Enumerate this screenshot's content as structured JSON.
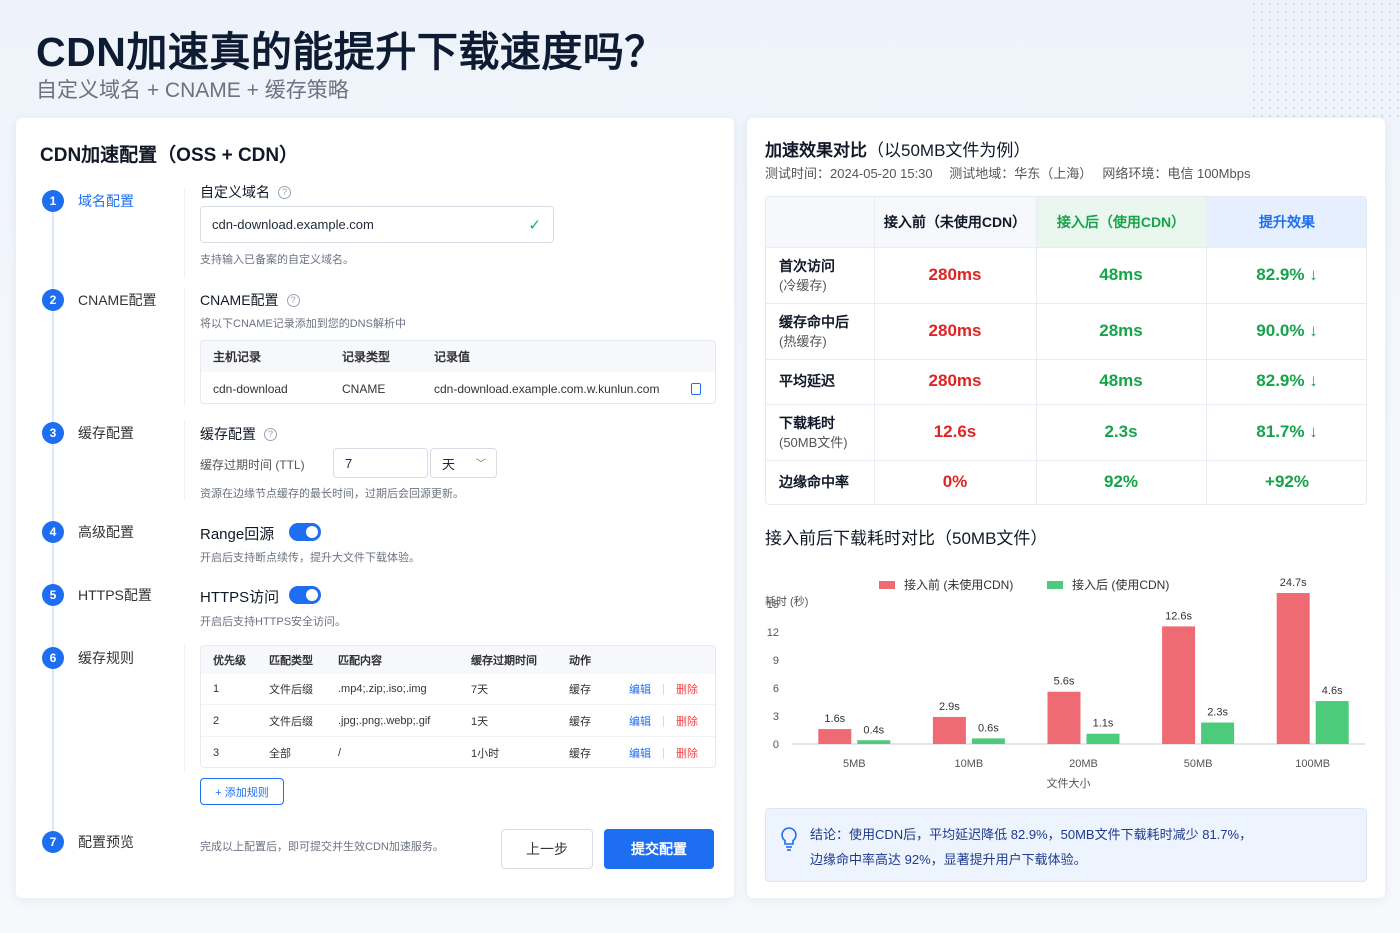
{
  "page": {
    "title": "CDN加速真的能提升下载速度吗？",
    "subtitle": "自定义域名 + CNAME + 缓存策略"
  },
  "left": {
    "title": "CDN加速配置（OSS + CDN）",
    "steps": [
      {
        "num": "1",
        "label": "域名配置"
      },
      {
        "num": "2",
        "label": "CNAME配置"
      },
      {
        "num": "3",
        "label": "缓存配置"
      },
      {
        "num": "4",
        "label": "高级配置"
      },
      {
        "num": "5",
        "label": "HTTPS配置"
      },
      {
        "num": "6",
        "label": "缓存规则"
      },
      {
        "num": "7",
        "label": "配置预览"
      }
    ],
    "domain": {
      "label": "自定义域名",
      "value": "cdn-download.example.com",
      "hint": "支持输入已备案的自定义域名。"
    },
    "cname": {
      "label": "CNAME配置",
      "hint": "将以下CNAME记录添加到您的DNS解析中",
      "headers": [
        "主机记录",
        "记录类型",
        "记录值"
      ],
      "row": [
        "cdn-download",
        "CNAME",
        "cdn-download.example.com.w.kunlun.com"
      ]
    },
    "cache": {
      "label": "缓存配置",
      "ttl_label": "缓存过期时间 (TTL)",
      "ttl_value": "7",
      "ttl_unit": "天",
      "hint": "资源在边缘节点缓存的最长时间，过期后会回源更新。"
    },
    "range": {
      "label": "Range回源",
      "hint": "开启后支持断点续传，提升大文件下载体验。"
    },
    "https": {
      "label": "HTTPS访问",
      "hint": "开启后支持HTTPS安全访问。"
    },
    "rules": {
      "headers": [
        "优先级",
        "匹配类型",
        "匹配内容",
        "缓存过期时间",
        "动作"
      ],
      "rows": [
        [
          "1",
          "文件后缀",
          ".mp4;.zip;.iso;.img",
          "7天",
          "缓存"
        ],
        [
          "2",
          "文件后缀",
          ".jpg;.png;.webp;.gif",
          "1天",
          "缓存"
        ],
        [
          "3",
          "全部",
          "/",
          "1小时",
          "缓存"
        ]
      ],
      "edit": "编辑",
      "delete": "删除",
      "add": "+ 添加规则"
    },
    "preview": {
      "hint": "完成以上配置后，即可提交并生效CDN加速服务。",
      "prev": "上一步",
      "submit": "提交配置"
    }
  },
  "right": {
    "title_bold": "加速效果对比",
    "title_rest": "（以50MB文件为例）",
    "meta": "测试时间：2024-05-20 15:30　 测试地域：华东（上海）　 网络环境：电信 100Mbps",
    "table_headers": [
      "接入前（未使用CDN）",
      "接入后（使用CDN）",
      "提升效果"
    ],
    "table_rows": [
      {
        "label": "首次访问",
        "sub": "(冷缓存)",
        "before": "280ms",
        "after": "48ms",
        "gain": "82.9% ↓"
      },
      {
        "label": "缓存命中后",
        "sub": "(热缓存)",
        "before": "280ms",
        "after": "28ms",
        "gain": "90.0% ↓"
      },
      {
        "label": "平均延迟",
        "sub": "",
        "before": "280ms",
        "after": "48ms",
        "gain": "82.9% ↓"
      },
      {
        "label": "下载耗时",
        "sub": "(50MB文件)",
        "before": "12.6s",
        "after": "2.3s",
        "gain": "81.7% ↓"
      },
      {
        "label": "边缘命中率",
        "sub": "",
        "before": "0%",
        "after": "92%",
        "gain": "+92%"
      }
    ],
    "chart_title": "接入前后下载耗时对比（50MB文件）",
    "conclusion_line1": "结论：使用CDN后，平均延迟降低 82.9%，50MB文件下载耗时减少 81.7%，",
    "conclusion_line2": "边缘命中率高达 92%，显著提升用户下载体验。"
  },
  "colors": {
    "accent": "#1e6ef2",
    "before": "#ef6b73",
    "after": "#4ccb7a",
    "red": "#e02424",
    "green": "#16a34a"
  },
  "chart_data": {
    "type": "bar",
    "title": "接入前后下载耗时对比（50MB文件）",
    "xlabel": "文件大小",
    "ylabel": "耗时 (秒)",
    "categories": [
      "5MB",
      "10MB",
      "20MB",
      "50MB",
      "100MB"
    ],
    "ylim": [
      0,
      15
    ],
    "yticks": [
      0,
      3,
      6,
      9,
      12,
      15
    ],
    "legend": "top",
    "series": [
      {
        "name": "接入前 (未使用CDN)",
        "values": [
          1.6,
          2.9,
          5.6,
          12.6,
          24.7
        ],
        "labels": [
          "1.6s",
          "2.9s",
          "5.6s",
          "12.6s",
          "24.7s"
        ],
        "color": "#ef6b73"
      },
      {
        "name": "接入后 (使用CDN)",
        "values": [
          0.4,
          0.6,
          1.1,
          2.3,
          4.6
        ],
        "labels": [
          "0.4s",
          "0.6s",
          "1.1s",
          "2.3s",
          "4.6s"
        ],
        "color": "#4ccb7a"
      }
    ]
  }
}
